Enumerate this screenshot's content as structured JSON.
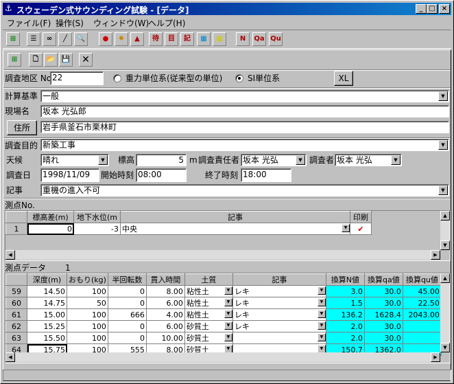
{
  "window": {
    "title": "スウェーデン式サウンディング試験 - [データ]"
  },
  "menu": [
    "ファイル(F)",
    "操作(S)",
    "ウィンドウ(W)",
    "ヘルプ(H)"
  ],
  "toolbar1": {
    "text_buttons": [
      "待",
      "目",
      "記",
      "N",
      "Qa",
      "Qu"
    ]
  },
  "survey": {
    "area_no_label": "調査地区 No.",
    "area_no_value": "22",
    "unit_option1": "重力単位系(従来型の単位)",
    "unit_option2": "SI単位系",
    "xl_button": "XL",
    "calc_basis_label": "計算基準",
    "calc_basis_value": "一般",
    "site_name_label": "現場名",
    "site_name_value": "坂本 光弘郎",
    "address_button": "住所",
    "address_value": "岩手県釜石市栗林町",
    "purpose_label": "調査目的",
    "purpose_value": "新築工事",
    "weather_label": "天候",
    "weather_value": "晴れ",
    "elevation_label": "標高",
    "elevation_value": "5",
    "elevation_unit": "m",
    "supervisor_label": "調査責任者",
    "supervisor_value": "坂本 光弘",
    "investigator_label": "調査者",
    "investigator_value": "坂本 光弘",
    "date_label": "調査日",
    "date_value": "1998/11/09",
    "start_label": "開始時刻",
    "start_value": "08:00",
    "end_label": "終了時刻",
    "end_value": "18:00",
    "notes_label": "記事",
    "notes_value": "重機の進入不可"
  },
  "points": {
    "section_label": "測点No.",
    "headers": [
      "標高差(m)",
      "地下水位(m",
      "記事",
      "印刷"
    ],
    "rows": [
      {
        "no": "1",
        "elev": "0",
        "water": "-3",
        "note": "中央"
      }
    ]
  },
  "measure": {
    "section_label": "測点データ",
    "section_no": "1",
    "headers": [
      "深度(m)",
      "おもり(kg)",
      "半回転数",
      "貫入時間",
      "土質",
      "記事",
      "換算N値",
      "換算qa値",
      "換算qu値"
    ],
    "rows": [
      {
        "no": "59",
        "depth": "14.50",
        "weight": "100",
        "turns": "0",
        "time": "8.00",
        "soil": "粘性土",
        "note": "レキ",
        "n": "3.0",
        "qa": "30.0",
        "qu": "45.00"
      },
      {
        "no": "60",
        "depth": "14.75",
        "weight": "50",
        "turns": "0",
        "time": "6.00",
        "soil": "粘性土",
        "note": "レキ",
        "n": "1.5",
        "qa": "30.0",
        "qu": "22.50"
      },
      {
        "no": "61",
        "depth": "15.00",
        "weight": "100",
        "turns": "666",
        "time": "4.00",
        "soil": "粘性土",
        "note": "レキ",
        "n": "136.2",
        "qa": "1628.4",
        "qu": "2043.00"
      },
      {
        "no": "62",
        "depth": "15.25",
        "weight": "100",
        "turns": "0",
        "time": "6.00",
        "soil": "砂質土",
        "note": "レキ",
        "n": "2.0",
        "qa": "30.0",
        "qu": ""
      },
      {
        "no": "63",
        "depth": "15.50",
        "weight": "100",
        "turns": "0",
        "time": "10.00",
        "soil": "砂質土",
        "note": "",
        "n": "2.0",
        "qa": "30.0",
        "qu": ""
      },
      {
        "no": "64",
        "depth": "15.75",
        "weight": "100",
        "turns": "555",
        "time": "8.00",
        "soil": "砂質土",
        "note": "",
        "n": "150.7",
        "qa": "1362.0",
        "qu": ""
      }
    ]
  }
}
